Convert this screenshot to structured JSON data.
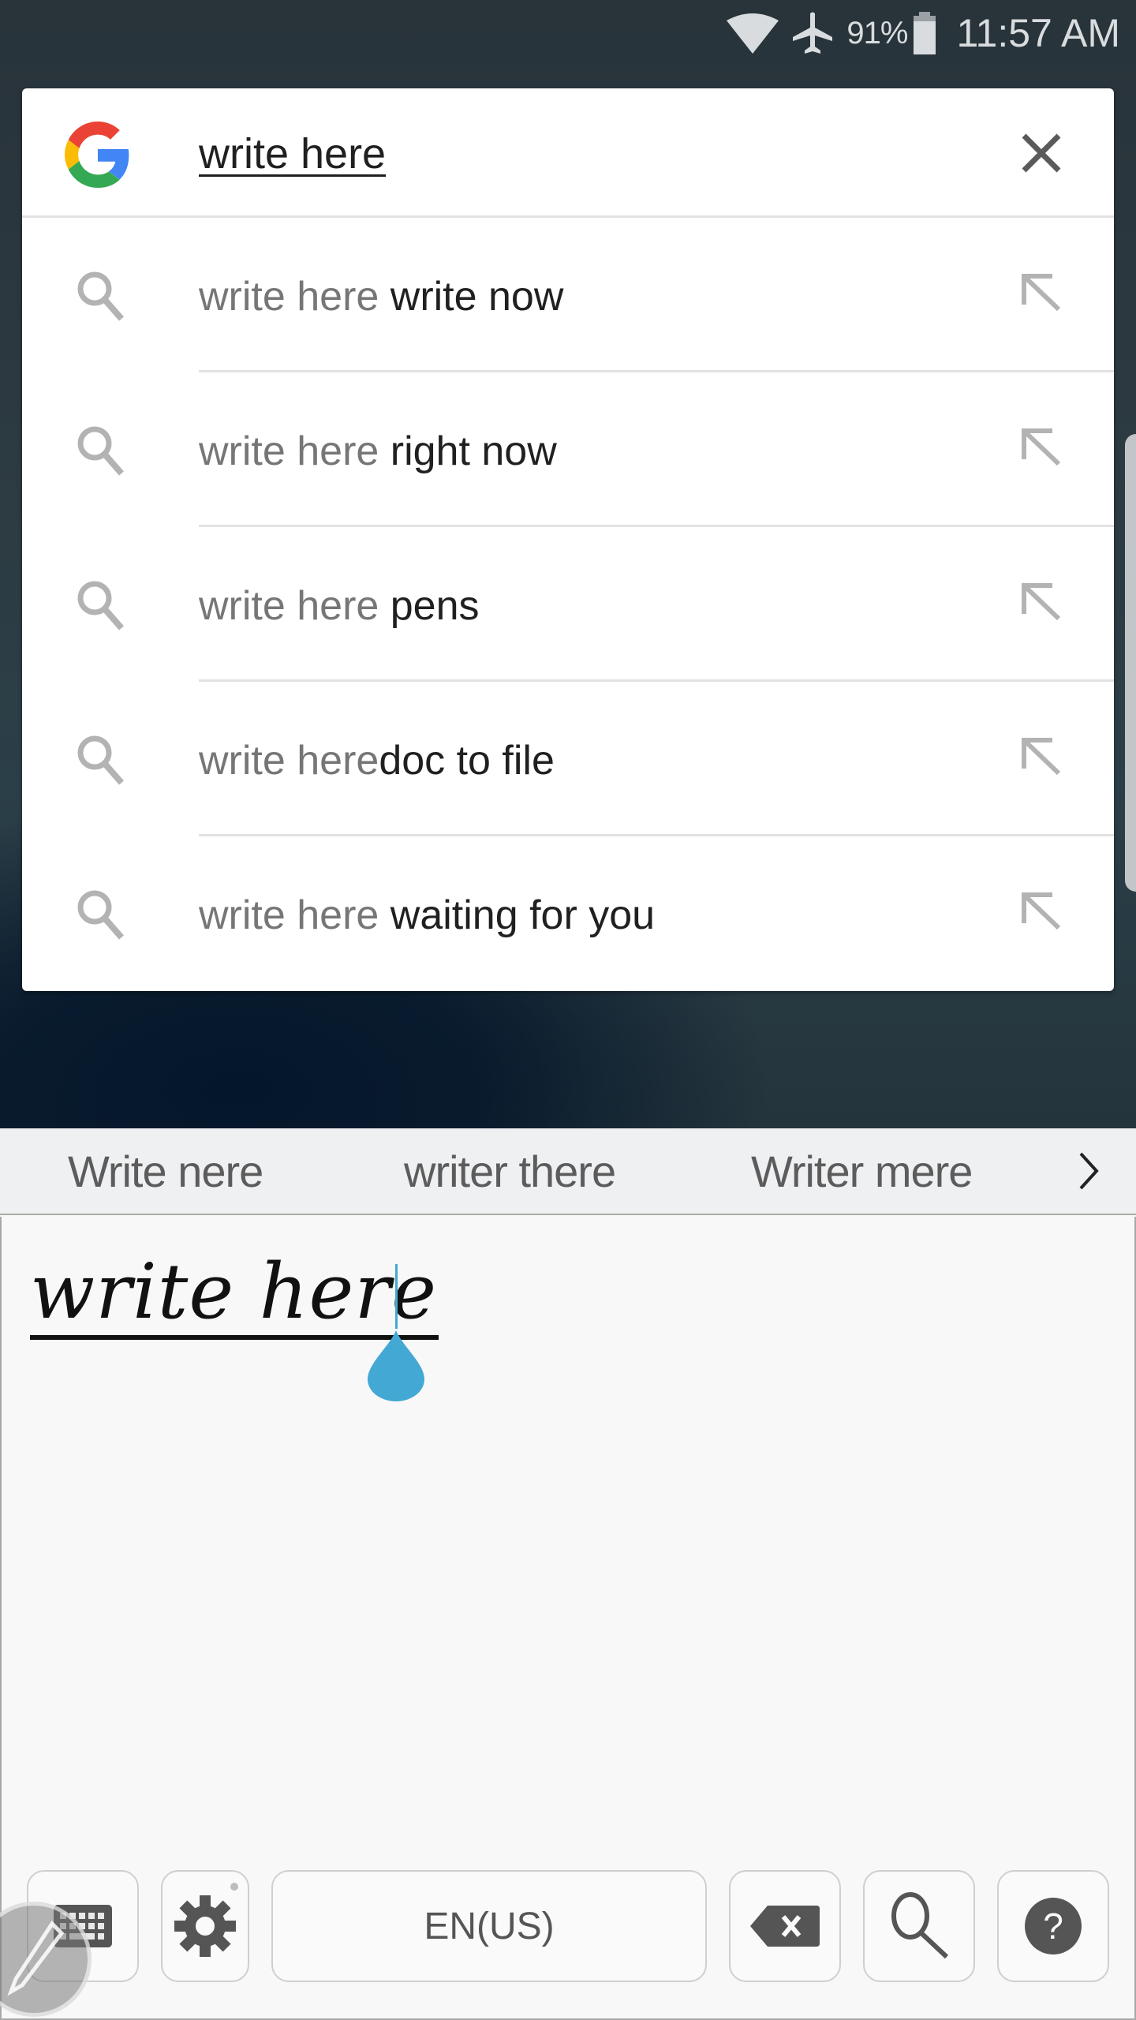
{
  "status_bar": {
    "battery_percent": "91%",
    "time": "11:57 AM",
    "icons": [
      "wifi-icon",
      "airplane-mode-icon",
      "battery-icon"
    ]
  },
  "search": {
    "query": "write here",
    "logo": "google-g-logo",
    "clear_icon": "close-icon",
    "suggestions": [
      {
        "typed": "write here",
        "completion": " write now"
      },
      {
        "typed": "write here",
        "completion": " right now"
      },
      {
        "typed": "write here",
        "completion": " pens"
      },
      {
        "typed": "write here",
        "completion": "doc to file"
      },
      {
        "typed": "write here",
        "completion": " waiting for you"
      }
    ]
  },
  "keyboard": {
    "candidates": [
      "Write nere",
      "writer there",
      "Writer mere"
    ],
    "more_candidates_icon": "chevron-right-icon",
    "handwriting_text": "write here",
    "language": "EN(US)",
    "keys": [
      "keyboard-icon",
      "gear-icon",
      "language",
      "backspace-icon",
      "search-icon",
      "help-icon"
    ],
    "accent_color": "#43a8d4"
  },
  "colors": {
    "google_red": "#ea4335",
    "google_yellow": "#fbbc05",
    "google_green": "#34a853",
    "google_blue": "#4285f4",
    "icon_gray": "#5a5a5a"
  }
}
